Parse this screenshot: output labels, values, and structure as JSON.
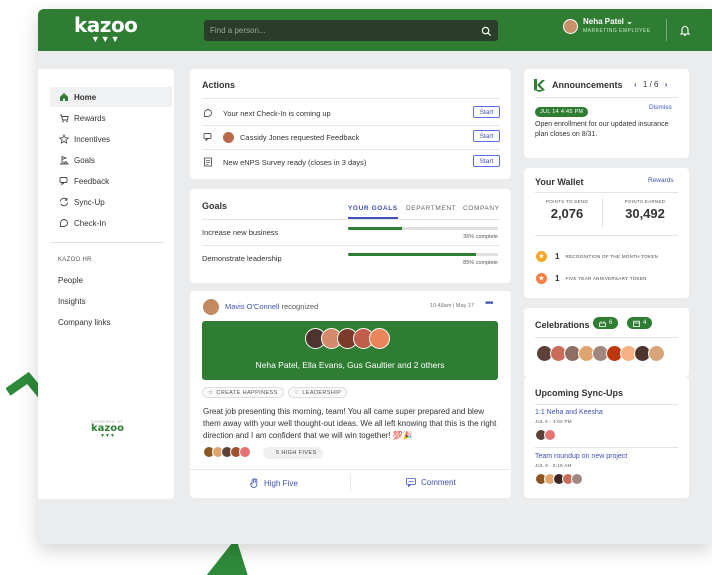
{
  "topbar": {
    "logo_word": "kazoo",
    "logo_mark": "▼▼▼",
    "search_placeholder": "Find a person...",
    "user_name": "Neha Patel",
    "user_caret": "⌄",
    "user_role": "MARKETING EMPLOYEE"
  },
  "sidebar": {
    "items": [
      {
        "label": "Home",
        "icon": "home-icon"
      },
      {
        "label": "Rewards",
        "icon": "cart-icon"
      },
      {
        "label": "Incentives",
        "icon": "star-icon"
      },
      {
        "label": "Goals",
        "icon": "goal-icon"
      },
      {
        "label": "Feedback",
        "icon": "feedback-icon"
      },
      {
        "label": "Sync-Up",
        "icon": "sync-icon"
      },
      {
        "label": "Check-In",
        "icon": "checkin-icon"
      }
    ],
    "section_label": "KAZOO HR",
    "links": [
      "People",
      "Insights",
      "Company links"
    ],
    "powered_by": "POWERED BY",
    "footer_logo": "kazoo",
    "footer_mark": "▼▼▼"
  },
  "actions": {
    "title": "Actions",
    "items": [
      {
        "text": "Your next Check-In is coming up",
        "button": "Start"
      },
      {
        "text": "Cassidy Jones requested Feedback",
        "button": "Start"
      },
      {
        "text": "New eNPS Survey ready (closes in 3 days)",
        "button": "Start"
      }
    ]
  },
  "goals": {
    "title": "Goals",
    "tabs": [
      "YOUR GOALS",
      "DEPARTMENT",
      "COMPANY"
    ],
    "items": [
      {
        "name": "Increase new business",
        "progress": 0.36,
        "label": "36% complete"
      },
      {
        "name": "Demonstrate leadership",
        "progress": 0.85,
        "label": "85% complete"
      }
    ]
  },
  "feed": {
    "author": "Mavis O'Connell",
    "verb": "recognized",
    "time": "10:48am | May 17",
    "more": "•••",
    "recipients": "Neha Patel, Ella Evans, Gus Gaultier and 2 others",
    "values": [
      "CREATE HAPPINESS",
      "LEADERSHIP"
    ],
    "message": "Great job presenting this morning, team! You all came super prepared and blew them away with your well thought-out ideas. We all left knowing that this is the right direction and I am confident that we will win together! 💯🎉",
    "high_fives": "5 HIGH FIVES",
    "high_five_label": "High Five",
    "comment_label": "Comment"
  },
  "announcements": {
    "title": "Announcements",
    "pager": "1 / 6",
    "prev": "‹",
    "next": "›",
    "date": "JUL 14 4:45 PM",
    "dismiss": "Dismiss",
    "text": "Open enrollment for our updated insurance plan closes on 8/31."
  },
  "wallet": {
    "title": "Your Wallet",
    "rewards_link": "Rewards",
    "send_label": "POINTS TO SEND",
    "send_value": "2,076",
    "earned_label": "POINTS EARNED",
    "earned_value": "30,492",
    "tokens": [
      {
        "count": "1",
        "name": "RECOGNITION OF THE MONTH TOKEN",
        "color": "#f5a623"
      },
      {
        "count": "1",
        "name": "FIVE YEAR ANNIVERSARY TOKEN",
        "color": "#f57f45"
      }
    ]
  },
  "celebrations": {
    "title": "Celebrations",
    "birthdays": "6",
    "anniversaries": "4"
  },
  "syncups": {
    "title": "Upcoming Sync-Ups",
    "items": [
      {
        "title": "1:1 Neha and Keesha",
        "time": "JUL 5 - 4:00 PM"
      },
      {
        "title": "Team roundup on new project",
        "time": "JUL 9 - 9:15 AM"
      }
    ]
  },
  "colors": {
    "brand_green": "#2e7d32",
    "link_blue": "#3f51b5",
    "background": "#ebecee"
  }
}
